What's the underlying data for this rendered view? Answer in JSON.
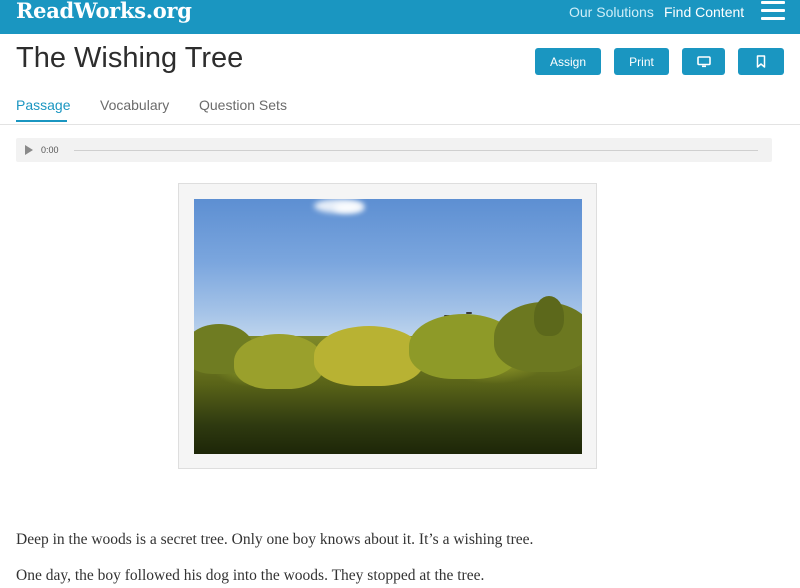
{
  "header": {
    "logo": "ReadWorks.org",
    "nav": [
      {
        "label": "Our Solutions"
      },
      {
        "label": "Find Content"
      }
    ],
    "menu_icon": "hamburger-menu-icon"
  },
  "page": {
    "title": "The Wishing Tree",
    "buttons": {
      "assign": "Assign",
      "print": "Print",
      "present_icon": "monitor-icon",
      "bookmark_icon": "bookmark-icon"
    }
  },
  "tabs": [
    {
      "label": "Passage",
      "active": true
    },
    {
      "label": "Vocabulary",
      "active": false
    },
    {
      "label": "Question Sets",
      "active": false
    }
  ],
  "audio": {
    "time": "0:00",
    "play_icon": "play-icon"
  },
  "image": {
    "description_icon": "passage-photo"
  },
  "passage": {
    "paragraphs": [
      "Deep in the woods is a secret tree. Only one boy knows about it. It’s a wishing tree.",
      "One day, the boy followed his dog into the woods. They stopped at the tree."
    ]
  },
  "colors": {
    "brand": "#1a96c1",
    "text": "#333333",
    "muted_tab": "#6b6b6b"
  }
}
